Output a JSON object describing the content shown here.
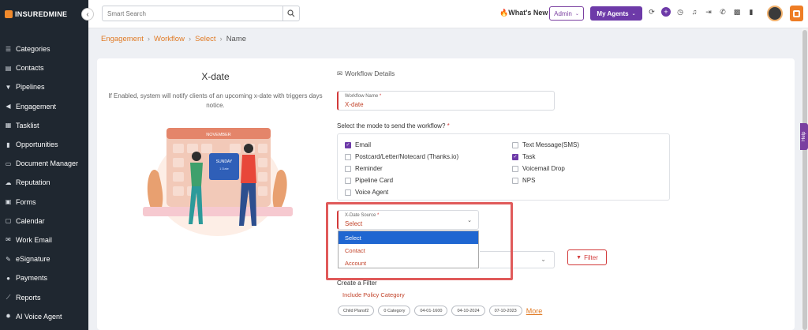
{
  "brand": {
    "name": "INSUREDMINE"
  },
  "sidebar": {
    "items": [
      {
        "label": "Categories",
        "icon": "list-icon"
      },
      {
        "label": "Contacts",
        "icon": "contacts-icon"
      },
      {
        "label": "Pipelines",
        "icon": "filter-icon"
      },
      {
        "label": "Engagement",
        "icon": "megaphone-icon"
      },
      {
        "label": "Tasklist",
        "icon": "tasklist-icon"
      },
      {
        "label": "Opportunities",
        "icon": "bar-chart-icon"
      },
      {
        "label": "Document Manager",
        "icon": "folder-icon"
      },
      {
        "label": "Reputation",
        "icon": "cloud-icon"
      },
      {
        "label": "Forms",
        "icon": "form-icon"
      },
      {
        "label": "Calendar",
        "icon": "calendar-icon"
      },
      {
        "label": "Work Email",
        "icon": "envelope-icon"
      },
      {
        "label": "eSignature",
        "icon": "signature-icon"
      },
      {
        "label": "Payments",
        "icon": "dollar-icon"
      },
      {
        "label": "Reports",
        "icon": "chart-icon"
      },
      {
        "label": "AI Voice Agent",
        "icon": "gear-icon"
      }
    ]
  },
  "topbar": {
    "search_placeholder": "Smart Search",
    "whats_new": "What's New",
    "admin": "Admin",
    "my_agents": "My Agents"
  },
  "breadcrumb": {
    "items": [
      "Engagement",
      "Workflow",
      "Select"
    ],
    "current": "Name"
  },
  "left_panel": {
    "title": "X-date",
    "description": "If Enabled, system will notify clients of an upcoming x-date with triggers days notice.",
    "illustration": {
      "month": "NOVEMBER",
      "card_line1": "SUNDAY",
      "card_line2": "1 Date"
    }
  },
  "workflow": {
    "section_title": "Workflow Details",
    "name_label": "Workflow Name",
    "name_value": "X-date",
    "mode_question": "Select the mode to send the workflow?",
    "modes": [
      {
        "label": "Email",
        "checked": true
      },
      {
        "label": "Text Message(SMS)",
        "checked": false
      },
      {
        "label": "Postcard/Letter/Notecard (Thanks.io)",
        "checked": false
      },
      {
        "label": "Task",
        "checked": true
      },
      {
        "label": "Reminder",
        "checked": false
      },
      {
        "label": "Voicemail Drop",
        "checked": false
      },
      {
        "label": "Pipeline Card",
        "checked": false
      },
      {
        "label": "NPS",
        "checked": false
      },
      {
        "label": "Voice Agent",
        "checked": false
      }
    ],
    "xdate_source_label": "X-Date Source",
    "xdate_source_value": "Select",
    "xdate_options": [
      "Select",
      "Contact",
      "Account"
    ],
    "filter_button": "Filter",
    "create_filter": "Create a Filter",
    "include_policy": "Include Policy Category",
    "chips": [
      "Child Plansf2",
      "0 Category",
      "04-01-1600",
      "04-10-2024",
      "07-10-2023"
    ],
    "more": "More"
  },
  "help_tab": "Help",
  "colors": {
    "accent": "#6d3aa8",
    "brand_orange": "#e07a24",
    "required_red": "#d23a3a",
    "sidebar_bg": "#1f2730",
    "dropdown_selected": "#1f66d1"
  }
}
